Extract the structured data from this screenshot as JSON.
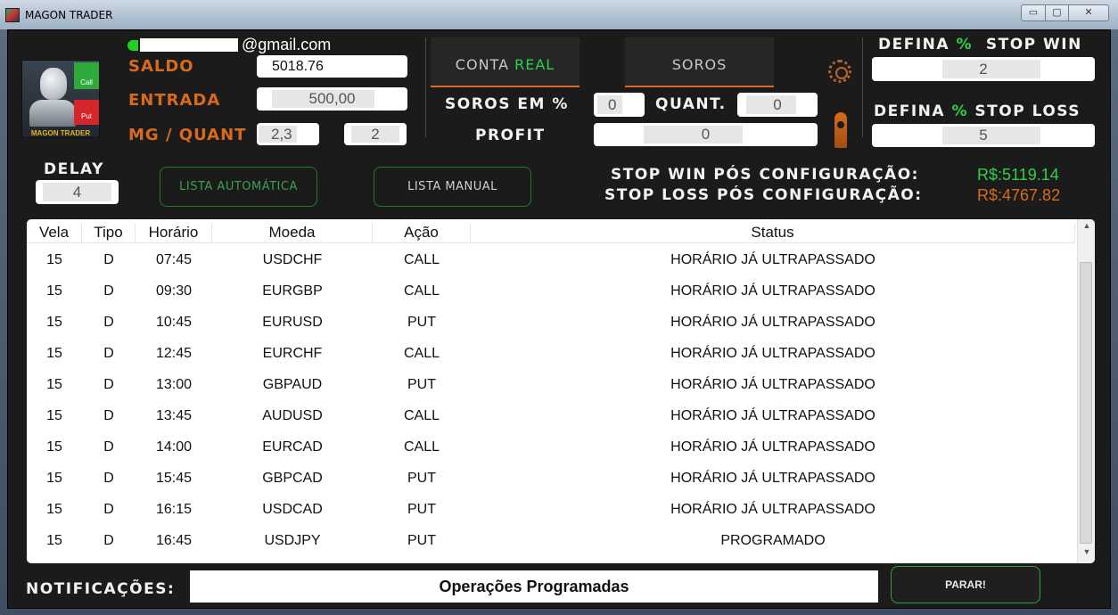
{
  "window": {
    "title": "MAGON TRADER",
    "min": "▭",
    "max": "▢",
    "close": "✕"
  },
  "account": {
    "email_suffix": "@gmail.com",
    "saldo_label": "SALDO",
    "saldo_value": "5018.76",
    "entrada_label": "ENTRADA",
    "entrada_value": "500,00",
    "mg_label": "MG / QUANT",
    "mg_value": "2,3",
    "quant_value": "2",
    "avatar_call": "Call",
    "avatar_put": "Put",
    "avatar_brand": "MAGON TRADER"
  },
  "tabs": {
    "conta_prefix": "CONTA ",
    "conta_mode": "REAL",
    "soros": "SOROS"
  },
  "soros": {
    "label": "SOROS EM %",
    "value": "0",
    "quant_label": "QUANT.",
    "quant_value": "0",
    "profit_label": "PROFIT",
    "profit_value": "0"
  },
  "stop": {
    "win_prefix": "DEFINA ",
    "win_pct": "%",
    "win_suffix": "  STOP WIN",
    "win_value": "2",
    "loss_prefix": "DEFINA ",
    "loss_pct": "%",
    "loss_suffix": " STOP LOSS",
    "loss_value": "5",
    "win_after_label": "STOP WIN PÓS CONFIGURAÇÃO:",
    "win_after_value": "R$:5119.14",
    "loss_after_label": "STOP LOSS PÓS CONFIGURAÇÃO:",
    "loss_after_value": "R$:4767.82"
  },
  "delay": {
    "label": "DELAY",
    "value": "4"
  },
  "buttons": {
    "auto": "LISTA AUTOMÁTICA",
    "manual": "LISTA MANUAL",
    "stop": "PARAR!"
  },
  "colors": {
    "accent_orange": "#d96a1c",
    "accent_green": "#2fd14a",
    "stop_loss_value": "#d96a1c"
  },
  "table": {
    "headers": [
      "Vela",
      "Tipo",
      "Horário",
      "Moeda",
      "Ação",
      "Status"
    ],
    "rows": [
      [
        "15",
        "D",
        "07:45",
        "USDCHF",
        "CALL",
        "HORÁRIO JÁ ULTRAPASSADO"
      ],
      [
        "15",
        "D",
        "09:30",
        "EURGBP",
        "CALL",
        "HORÁRIO JÁ ULTRAPASSADO"
      ],
      [
        "15",
        "D",
        "10:45",
        "EURUSD",
        "PUT",
        "HORÁRIO JÁ ULTRAPASSADO"
      ],
      [
        "15",
        "D",
        "12:45",
        "EURCHF",
        "CALL",
        "HORÁRIO JÁ ULTRAPASSADO"
      ],
      [
        "15",
        "D",
        "13:00",
        "GBPAUD",
        "PUT",
        "HORÁRIO JÁ ULTRAPASSADO"
      ],
      [
        "15",
        "D",
        "13:45",
        "AUDUSD",
        "CALL",
        "HORÁRIO JÁ ULTRAPASSADO"
      ],
      [
        "15",
        "D",
        "14:00",
        "EURCAD",
        "CALL",
        "HORÁRIO JÁ ULTRAPASSADO"
      ],
      [
        "15",
        "D",
        "15:45",
        "GBPCAD",
        "PUT",
        "HORÁRIO JÁ ULTRAPASSADO"
      ],
      [
        "15",
        "D",
        "16:15",
        "USDCAD",
        "PUT",
        "HORÁRIO JÁ ULTRAPASSADO"
      ],
      [
        "15",
        "D",
        "16:45",
        "USDJPY",
        "PUT",
        "PROGRAMADO"
      ]
    ]
  },
  "notifications": {
    "label": "NOTIFICAÇÕES:",
    "message": "Operações Programadas"
  },
  "scroll": {
    "up": "▲",
    "down": "▼"
  }
}
